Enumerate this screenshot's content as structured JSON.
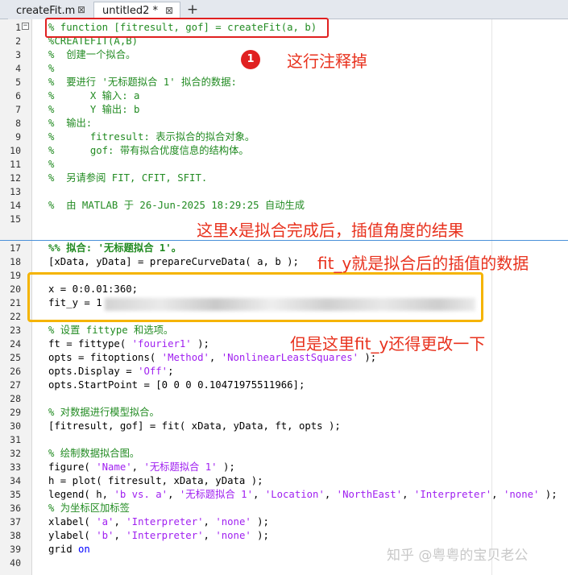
{
  "tabs": [
    {
      "label": "createFit.m",
      "active": false
    },
    {
      "label": "untitled2 *",
      "active": true
    }
  ],
  "tab_close_glyph": "⊠",
  "tab_add_glyph": "+",
  "fold_glyph": "−",
  "line_numbers": [
    "1",
    "2",
    "3",
    "4",
    "5",
    "6",
    "7",
    "8",
    "9",
    "10",
    "11",
    "12",
    "13",
    "14",
    "15",
    "17",
    "18",
    "19",
    "20",
    "21",
    "22",
    "23",
    "24",
    "25",
    "26",
    "27",
    "28",
    "29",
    "30",
    "31",
    "32",
    "33",
    "34",
    "35",
    "36",
    "37",
    "38",
    "39",
    "40"
  ],
  "code": {
    "l1": "% function [fitresult, gof] = createFit(a, b)",
    "l2": "%CREATEFIT(A,B)",
    "l3": "%  创建一个拟合。",
    "l4": "%",
    "l5": "%  要进行 '无标题拟合 1' 拟合的数据:",
    "l6": "%      X 输入: a",
    "l7": "%      Y 输出: b",
    "l8": "%  输出:",
    "l9": "%      fitresult: 表示拟合的拟合对象。",
    "l10": "%      gof: 带有拟合优度信息的结构体。",
    "l11": "%",
    "l12": "%  另请参阅 FIT, CFIT, SFIT.",
    "l14": "%  由 MATLAB 于 26-Jun-2025 18:29:25 自动生成",
    "l17": "%% 拟合: '无标题拟合 1'。",
    "l18": "[xData, yData] = prepareCurveData( a, b );",
    "l20": "x = 0:0.01:360;",
    "l21": "fit_y = 1",
    "l23": "% 设置 fittype 和选项。",
    "l24a": "ft = fittype( ",
    "l24s": "'fourier1'",
    "l24b": " );",
    "l25a": "opts = fitoptions( ",
    "l25s1": "'Method'",
    "l25m": ", ",
    "l25s2": "'NonlinearLeastSquares'",
    "l25b": " );",
    "l26a": "opts.Display = ",
    "l26s": "'Off'",
    "l26b": ";",
    "l27": "opts.StartPoint = [0 0 0 0.10471975511966];",
    "l29": "% 对数据进行模型拟合。",
    "l30": "[fitresult, gof] = fit( xData, yData, ft, opts );",
    "l32": "% 绘制数据拟合图。",
    "l33a": "figure( ",
    "l33s1": "'Name'",
    "l33m": ", ",
    "l33s2": "'无标题拟合 1'",
    "l33b": " );",
    "l34": "h = plot( fitresult, xData, yData );",
    "l35a": "legend( h, ",
    "l35s1": "'b vs. a'",
    "l35m1": ", ",
    "l35s2": "'无标题拟合 1'",
    "l35m2": ", ",
    "l35s3": "'Location'",
    "l35m3": ", ",
    "l35s4": "'NorthEast'",
    "l35m4": ", ",
    "l35s5": "'Interpreter'",
    "l35m5": ", ",
    "l35s6": "'none'",
    "l35b": " );",
    "l36": "% 为坐标区加标签",
    "l37a": "xlabel( ",
    "l37s1": "'a'",
    "l37m": ", ",
    "l37s2": "'Interpreter'",
    "l37m2": ", ",
    "l37s3": "'none'",
    "l37b": " );",
    "l38a": "ylabel( ",
    "l38s1": "'b'",
    "l38m": ", ",
    "l38s2": "'Interpreter'",
    "l38m2": ", ",
    "l38s3": "'none'",
    "l38b": " );",
    "l39a": "grid ",
    "l39k": "on"
  },
  "annotations": {
    "badge": "1",
    "comment_out": "这行注释掉",
    "x_result": "这里x是拟合完成后，插值角度的结果",
    "fit_y_data": "fit_y就是拟合后的插值的数据",
    "fit_y_change": "但是这里fit_y还得更改一下"
  },
  "watermark": "知乎 @粤粤的宝贝老公",
  "colors": {
    "comment": "#228b22",
    "string": "#a020f0",
    "keyword": "#0000ff",
    "annotation": "#e8321e",
    "highlight_red": "#e02020",
    "highlight_yellow": "#f5b400"
  }
}
